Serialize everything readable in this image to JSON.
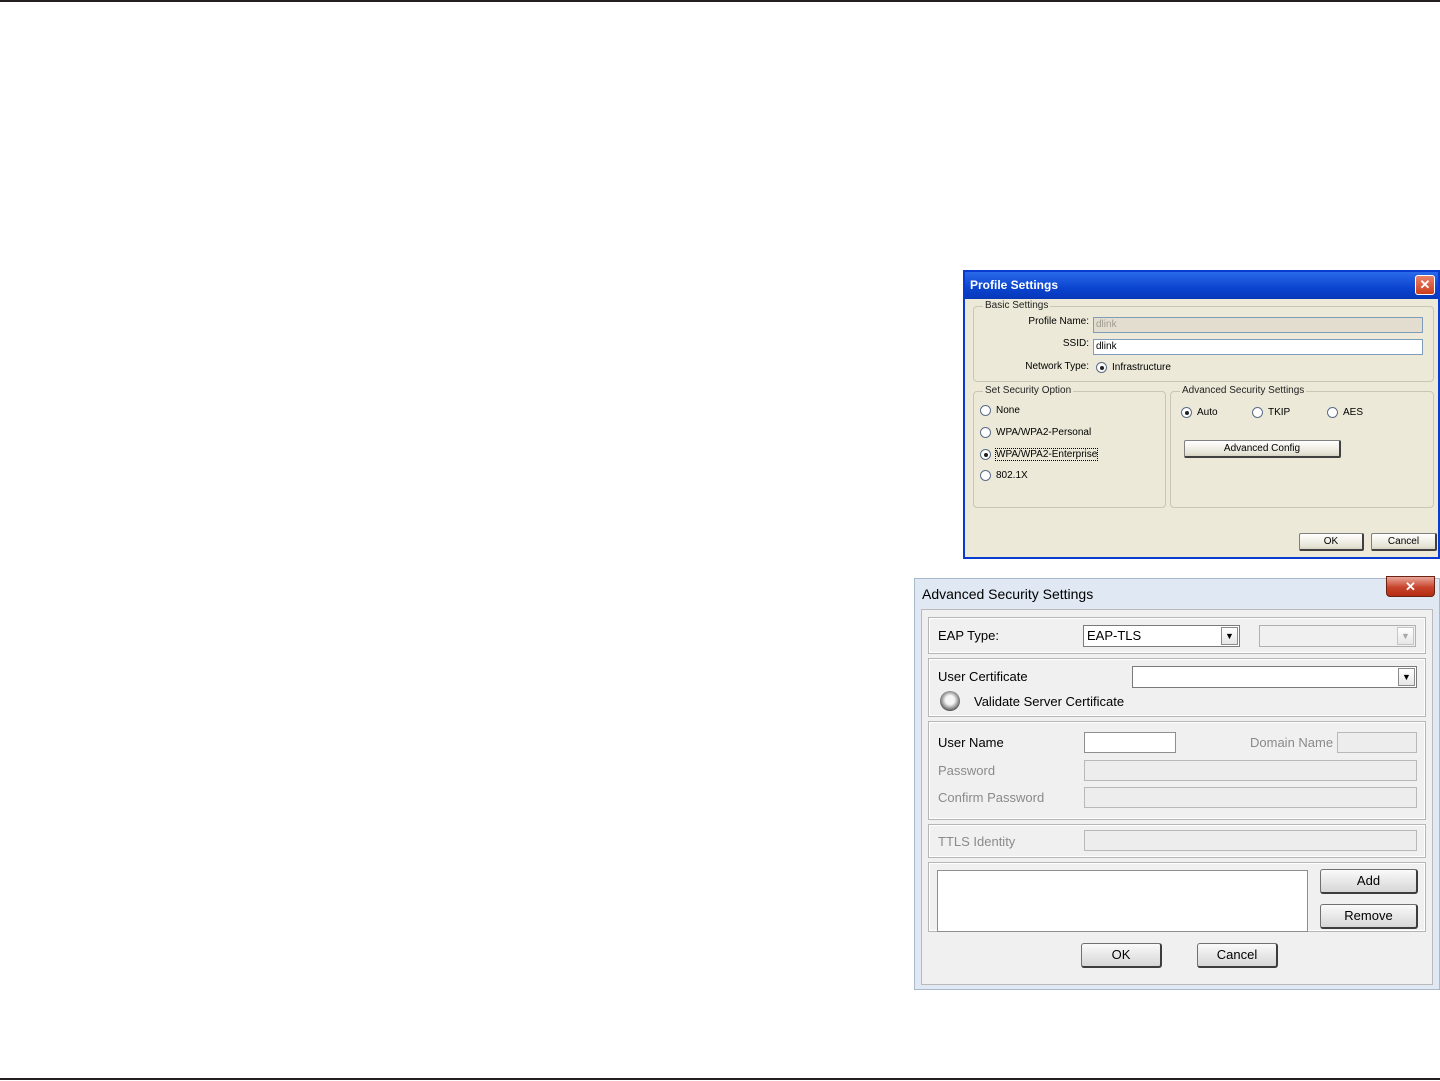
{
  "profile_settings": {
    "title": "Profile Settings",
    "close_glyph": "✕",
    "basic": {
      "legend": "Basic Settings",
      "profile_name_label": "Profile Name:",
      "profile_name_value": "dlink",
      "ssid_label": "SSID:",
      "ssid_value": "dlink",
      "network_type_label": "Network Type:",
      "network_type_option": "Infrastructure"
    },
    "security_option": {
      "legend": "Set Security Option",
      "options": [
        "None",
        "WPA/WPA2-Personal",
        "WPA/WPA2-Enterprise",
        "802.1X"
      ],
      "selected": "WPA/WPA2-Enterprise"
    },
    "advanced": {
      "legend": "Advanced Security Settings",
      "options": [
        "Auto",
        "TKIP",
        "AES"
      ],
      "selected": "Auto",
      "config_button": "Advanced Config"
    },
    "ok_button": "OK",
    "cancel_button": "Cancel"
  },
  "advanced_security": {
    "title": "Advanced Security Settings",
    "close_glyph": "✕",
    "eap_type_label": "EAP Type:",
    "eap_type_value": "EAP-TLS",
    "eap_sub_value": "",
    "user_certificate_label": "User Certificate",
    "user_certificate_value": "",
    "validate_server_label": "Validate Server Certificate",
    "user_name_label": "User Name",
    "domain_name_label": "Domain Name",
    "password_label": "Password",
    "confirm_password_label": "Confirm Password",
    "ttls_identity_label": "TTLS Identity",
    "add_button": "Add",
    "remove_button": "Remove",
    "ok_button": "OK",
    "cancel_button": "Cancel",
    "dropdown_arrow": "▼"
  }
}
